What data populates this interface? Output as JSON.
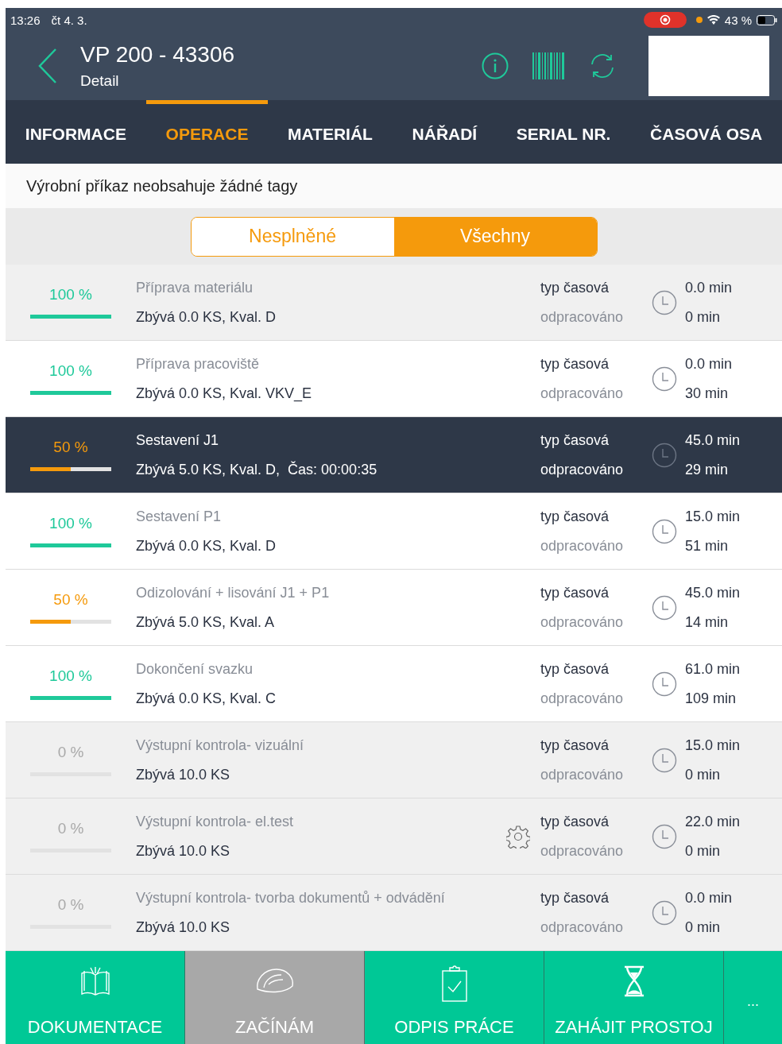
{
  "status_bar": {
    "time": "13:26",
    "date": "čt 4. 3.",
    "battery": "43 %"
  },
  "header": {
    "title": "VP 200 - 43306",
    "subtitle": "Detail"
  },
  "tabs": [
    {
      "label": "INFORMACE",
      "selected": false
    },
    {
      "label": "OPERACE",
      "selected": true
    },
    {
      "label": "MATERIÁL",
      "selected": false
    },
    {
      "label": "NÁŘADÍ",
      "selected": false
    },
    {
      "label": "SERIAL NR.",
      "selected": false
    },
    {
      "label": "ČASOVÁ OSA",
      "selected": false
    }
  ],
  "tag_message": "Výrobní příkaz neobsahuje žádné tagy",
  "filter": [
    {
      "label": "Nesplněné",
      "selected": false
    },
    {
      "label": "Všechny",
      "selected": true
    }
  ],
  "operations": [
    {
      "percent": "100 %",
      "level": 1,
      "name": "Příprava materiálu",
      "detail": "Zbývá 0.0 KS, Kval. D",
      "type": "typ časová",
      "worked_label": "odpracováno",
      "planned": "0.0 min",
      "worked": "0 min",
      "selected": false,
      "shaded": true,
      "gear": false
    },
    {
      "percent": "100 %",
      "level": 1,
      "name": "Příprava pracoviště",
      "detail": "Zbývá 0.0 KS, Kval. VKV_E",
      "type": "typ časová",
      "worked_label": "odpracováno",
      "planned": "0.0 min",
      "worked": "30 min",
      "selected": false,
      "shaded": false,
      "gear": false
    },
    {
      "percent": "50 %",
      "level": 0.5,
      "name": "Sestavení J1",
      "detail": "Zbývá 5.0 KS, Kval. D,  Čas: 00:00:35",
      "type": "typ časová",
      "worked_label": "odpracováno",
      "planned": "45.0 min",
      "worked": "29 min",
      "selected": true,
      "gear": false
    },
    {
      "percent": "100 %",
      "level": 1,
      "name": "Sestavení P1",
      "detail": "Zbývá 0.0 KS, Kval. D",
      "type": "typ časová",
      "worked_label": "odpracováno",
      "planned": "15.0 min",
      "worked": "51 min",
      "selected": false,
      "shaded": false,
      "gear": false
    },
    {
      "percent": "50 %",
      "level": 0.5,
      "name": "Odizolování + lisování J1 + P1",
      "detail": "Zbývá 5.0 KS, Kval. A",
      "type": "typ časová",
      "worked_label": "odpracováno",
      "planned": "45.0 min",
      "worked": "14 min",
      "selected": false,
      "shaded": false,
      "gear": false
    },
    {
      "percent": "100 %",
      "level": 1,
      "name": "Dokončení svazku",
      "detail": "Zbývá 0.0 KS, Kval. C",
      "type": "typ časová",
      "worked_label": "odpracováno",
      "planned": "61.0 min",
      "worked": "109 min",
      "selected": false,
      "shaded": false,
      "gear": false
    },
    {
      "percent": "0 %",
      "level": 0,
      "name": "Výstupní kontrola- vizuální",
      "detail": "Zbývá 10.0 KS",
      "type": "typ časová",
      "worked_label": "odpracováno",
      "planned": "15.0 min",
      "worked": "0 min",
      "selected": false,
      "shaded": true,
      "gear": false
    },
    {
      "percent": "0 %",
      "level": 0,
      "name": "Výstupní kontrola- el.test",
      "detail": "Zbývá 10.0 KS",
      "type": "typ časová",
      "worked_label": "odpracováno",
      "planned": "22.0 min",
      "worked": "0 min",
      "selected": false,
      "shaded": true,
      "gear": true
    },
    {
      "percent": "0 %",
      "level": 0,
      "name": "Výstupní kontrola- tvorba dokumentů + odvádění",
      "detail": "Zbývá 10.0 KS",
      "type": "typ časová",
      "worked_label": "odpracováno",
      "planned": "0.0 min",
      "worked": "0 min",
      "selected": false,
      "shaded": true,
      "gear": false
    }
  ],
  "actions": [
    {
      "kind": "book",
      "label": "DOKUMENTACE",
      "disabled": false
    },
    {
      "kind": "helmet",
      "label": "ZAČÍNÁM",
      "disabled": true
    },
    {
      "kind": "clipboard",
      "label": "ODPIS PRÁCE",
      "disabled": false
    },
    {
      "kind": "hourglass",
      "label": "ZAHÁJIT PROSTOJ",
      "disabled": false
    }
  ],
  "more": "..."
}
